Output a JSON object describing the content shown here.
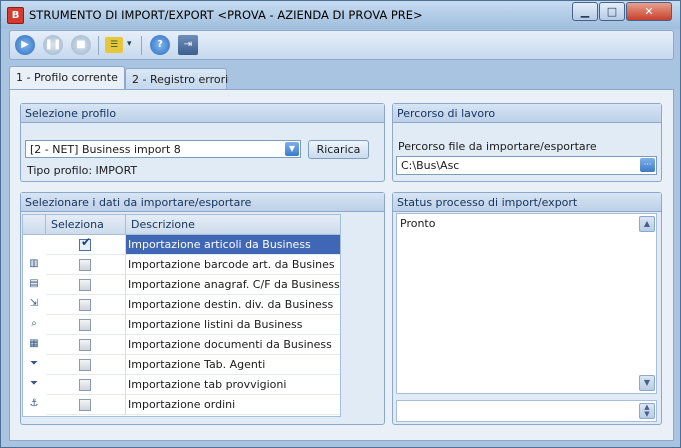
{
  "window": {
    "title": "STRUMENTO DI IMPORT/EXPORT <PROVA - AZIENDA DI PROVA PRE>",
    "controls": {
      "minimize": "▁",
      "maximize": "□",
      "close": "✕"
    }
  },
  "toolbar": {
    "icons": [
      "play-icon",
      "pause-icon",
      "stop-icon",
      "list-icon",
      "help-icon",
      "exit-icon"
    ],
    "dropdown_caret": "▾"
  },
  "tabs": [
    {
      "label": "1 - Profilo corrente",
      "active": true
    },
    {
      "label": "2 - Registro errori",
      "active": false
    }
  ],
  "profile": {
    "header": "Selezione profilo",
    "selected": "[2 - NET] Business import 8",
    "reload_label": "Ricarica",
    "type_label": "Tipo profilo: IMPORT"
  },
  "workpath": {
    "header": "Percorso di lavoro",
    "field_label": "Percorso file da importare/esportare",
    "value": "C:\\Bus\\Asc",
    "browse_label": "···"
  },
  "data_selection": {
    "header": "Selezionare i dati da importare/esportare",
    "columns": [
      "Seleziona",
      "Descrizione"
    ],
    "rows": [
      {
        "checked": true,
        "selected": true,
        "icon": "",
        "description": "Importazione articoli da Business"
      },
      {
        "checked": false,
        "selected": false,
        "icon": "barcode-icon",
        "description": "Importazione barcode art. da Busines"
      },
      {
        "checked": false,
        "selected": false,
        "icon": "document-icon",
        "description": "Importazione anagraf. C/F da Business"
      },
      {
        "checked": false,
        "selected": false,
        "icon": "import-icon",
        "description": "Importazione destin. div. da Business"
      },
      {
        "checked": false,
        "selected": false,
        "icon": "magnifier-icon",
        "description": "Importazione listini da Business"
      },
      {
        "checked": false,
        "selected": false,
        "icon": "grid-icon",
        "description": "Importazione documenti da Business"
      },
      {
        "checked": false,
        "selected": false,
        "icon": "filter-icon",
        "description": "Importazione Tab. Agenti"
      },
      {
        "checked": false,
        "selected": false,
        "icon": "filter-plus-icon",
        "description": "Importazione tab provvigioni"
      },
      {
        "checked": false,
        "selected": false,
        "icon": "anchor-icon",
        "description": "Importazione ordini"
      }
    ]
  },
  "status": {
    "header": "Status processo di import/export",
    "text": "Pronto"
  }
}
